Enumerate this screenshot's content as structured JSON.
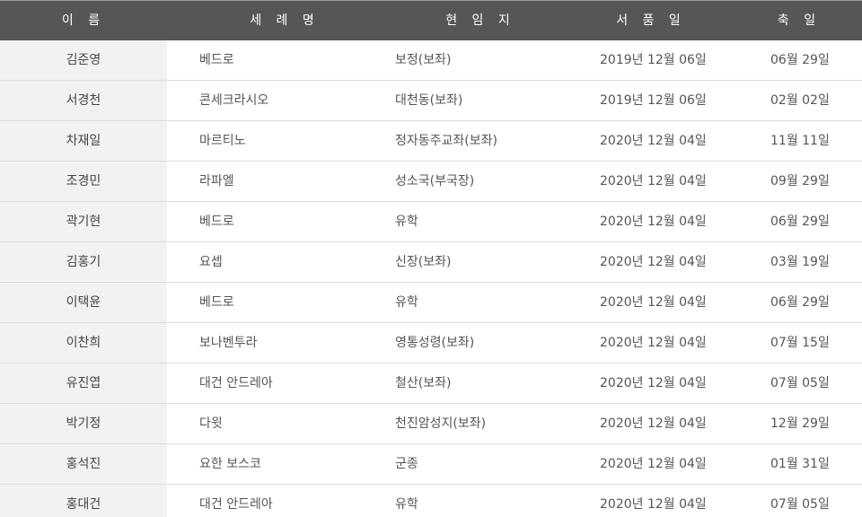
{
  "header": {
    "name": "이 름",
    "baptismal_name": "세 례 명",
    "current_post": "현 임 지",
    "ordination_date": "서 품 일",
    "feast_day": "축 일"
  },
  "rows": [
    {
      "name": "김준영",
      "baptismal_name": "베드로",
      "current_post": "보정(보좌)",
      "ordination_date": "2019년 12월 06일",
      "feast_day": "06월 29일"
    },
    {
      "name": "서경천",
      "baptismal_name": "콘세크라시오",
      "current_post": "대천동(보좌)",
      "ordination_date": "2019년 12월 06일",
      "feast_day": "02월 02일"
    },
    {
      "name": "차재일",
      "baptismal_name": "마르티노",
      "current_post": "정자동주교좌(보좌)",
      "ordination_date": "2020년 12월 04일",
      "feast_day": "11월 11일"
    },
    {
      "name": "조경민",
      "baptismal_name": "라파엘",
      "current_post": "성소국(부국장)",
      "ordination_date": "2020년 12월 04일",
      "feast_day": "09월 29일"
    },
    {
      "name": "곽기현",
      "baptismal_name": "베드로",
      "current_post": "유학",
      "ordination_date": "2020년 12월 04일",
      "feast_day": "06월 29일"
    },
    {
      "name": "김홍기",
      "baptismal_name": "요셉",
      "current_post": "신장(보좌)",
      "ordination_date": "2020년 12월 04일",
      "feast_day": "03월 19일"
    },
    {
      "name": "이택윤",
      "baptismal_name": "베드로",
      "current_post": "유학",
      "ordination_date": "2020년 12월 04일",
      "feast_day": "06월 29일"
    },
    {
      "name": "이찬희",
      "baptismal_name": "보나벤투라",
      "current_post": "영통성령(보좌)",
      "ordination_date": "2020년 12월 04일",
      "feast_day": "07월 15일"
    },
    {
      "name": "유진엽",
      "baptismal_name": "대건 안드레아",
      "current_post": "철산(보좌)",
      "ordination_date": "2020년 12월 04일",
      "feast_day": "07월 05일"
    },
    {
      "name": "박기정",
      "baptismal_name": "다윗",
      "current_post": "천진암성지(보좌)",
      "ordination_date": "2020년 12월 04일",
      "feast_day": "12월 29일"
    },
    {
      "name": "홍석진",
      "baptismal_name": "요한 보스코",
      "current_post": "군종",
      "ordination_date": "2020년 12월 04일",
      "feast_day": "01월 31일"
    },
    {
      "name": "홍대건",
      "baptismal_name": "대건 안드레아",
      "current_post": "유학",
      "ordination_date": "2020년 12월 04일",
      "feast_day": "07월 05일"
    }
  ],
  "colors": {
    "header_bg": "#565656",
    "header_text": "#ffffff",
    "name_column_bg": "#f2f2f2",
    "row_divider": "#dcdcdc",
    "body_text": "#555555"
  }
}
